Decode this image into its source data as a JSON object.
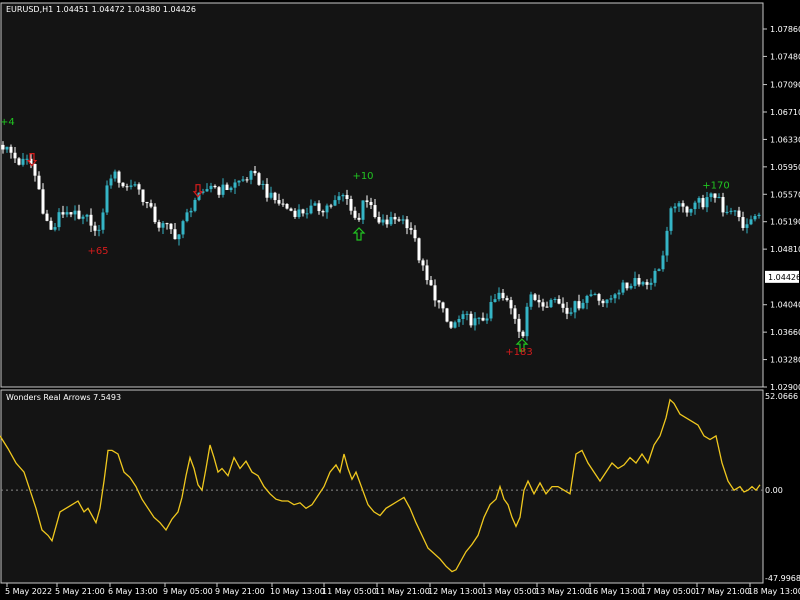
{
  "header": {
    "symbol": "EURUSD,H1",
    "ohlc": "1.04451 1.04472 1.04380 1.04426"
  },
  "indicator": {
    "name": "Wonders Real Arrows 7.5493"
  },
  "colors": {
    "background": "#000000",
    "plot_bg": "#141414",
    "axis": "#c8c8c8",
    "bull": "#35b5c6",
    "bear": "#ffffff",
    "buy": "#21c421",
    "sell": "#d41c1c",
    "osc": "#f0c81e",
    "zero": "#8a8a8a",
    "price_tag_bg": "#ffffff",
    "price_tag_fg": "#000000"
  },
  "chart_data": [
    {
      "type": "candlestick",
      "title": "EURUSD,H1",
      "ylim": [
        1.029,
        1.0822
      ],
      "y_ticks": [
        "1.07860",
        "1.07480",
        "1.07090",
        "1.06710",
        "1.06330",
        "1.05950",
        "1.05570",
        "1.05190",
        "1.04810",
        "1.04426",
        "1.04040",
        "1.03660",
        "1.03280",
        "1.02900"
      ],
      "current_price": "1.04426",
      "x_ticks": [
        "5 May 2022",
        "5 May 21:00",
        "6 May 13:00",
        "9 May 05:00",
        "9 May 21:00",
        "10 May 13:00",
        "11 May 05:00",
        "11 May 21:00",
        "12 May 13:00",
        "13 May 05:00",
        "13 May 21:00",
        "16 May 13:00",
        "17 May 05:00",
        "17 May 21:00",
        "18 May 13:00"
      ],
      "close_path": [
        [
          0,
          1.0628
        ],
        [
          10,
          1.0615
        ],
        [
          20,
          1.06
        ],
        [
          30,
          1.0603
        ],
        [
          38,
          1.057
        ],
        [
          45,
          1.0525
        ],
        [
          52,
          1.0503
        ],
        [
          60,
          1.053
        ],
        [
          70,
          1.0535
        ],
        [
          80,
          1.0518
        ],
        [
          90,
          1.0525
        ],
        [
          98,
          1.0492
        ],
        [
          104,
          1.0545
        ],
        [
          110,
          1.0585
        ],
        [
          118,
          1.058
        ],
        [
          126,
          1.0565
        ],
        [
          134,
          1.0575
        ],
        [
          142,
          1.0555
        ],
        [
          150,
          1.0535
        ],
        [
          158,
          1.0515
        ],
        [
          168,
          1.051
        ],
        [
          178,
          1.0498
        ],
        [
          186,
          1.0525
        ],
        [
          194,
          1.055
        ],
        [
          202,
          1.0552
        ],
        [
          210,
          1.0572
        ],
        [
          220,
          1.0562
        ],
        [
          230,
          1.0568
        ],
        [
          240,
          1.0575
        ],
        [
          250,
          1.0583
        ],
        [
          260,
          1.0575
        ],
        [
          270,
          1.0552
        ],
        [
          280,
          1.0545
        ],
        [
          290,
          1.0535
        ],
        [
          300,
          1.0532
        ],
        [
          310,
          1.0536
        ],
        [
          322,
          1.0538
        ],
        [
          334,
          1.0545
        ],
        [
          344,
          1.0555
        ],
        [
          352,
          1.0538
        ],
        [
          358,
          1.0512
        ],
        [
          364,
          1.0562
        ],
        [
          370,
          1.0538
        ],
        [
          378,
          1.0515
        ],
        [
          388,
          1.0518
        ],
        [
          398,
          1.0525
        ],
        [
          410,
          1.0515
        ],
        [
          418,
          1.0475
        ],
        [
          426,
          1.0438
        ],
        [
          434,
          1.042
        ],
        [
          442,
          1.0395
        ],
        [
          450,
          1.037
        ],
        [
          458,
          1.0382
        ],
        [
          468,
          1.0385
        ],
        [
          478,
          1.0378
        ],
        [
          488,
          1.0392
        ],
        [
          498,
          1.0418
        ],
        [
          508,
          1.0405
        ],
        [
          516,
          1.0385
        ],
        [
          522,
          1.0358
        ],
        [
          528,
          1.0412
        ],
        [
          536,
          1.0412
        ],
        [
          546,
          1.0408
        ],
        [
          556,
          1.0412
        ],
        [
          566,
          1.0398
        ],
        [
          576,
          1.0402
        ],
        [
          586,
          1.0415
        ],
        [
          596,
          1.0422
        ],
        [
          606,
          1.0402
        ],
        [
          616,
          1.0425
        ],
        [
          626,
          1.0428
        ],
        [
          636,
          1.0442
        ],
        [
          646,
          1.0432
        ],
        [
          656,
          1.0448
        ],
        [
          664,
          1.0475
        ],
        [
          670,
          1.0525
        ],
        [
          674,
          1.0548
        ],
        [
          680,
          1.0535
        ],
        [
          688,
          1.0538
        ],
        [
          696,
          1.0548
        ],
        [
          704,
          1.0545
        ],
        [
          712,
          1.0552
        ],
        [
          718,
          1.0558
        ],
        [
          724,
          1.0532
        ],
        [
          730,
          1.054
        ],
        [
          738,
          1.0525
        ],
        [
          746,
          1.0508
        ],
        [
          752,
          1.0525
        ],
        [
          762,
          1.0525
        ]
      ],
      "signals": [
        {
          "kind": "buy-label",
          "text": "+4",
          "x": 0,
          "y": 1.0653
        },
        {
          "kind": "sell-arrow",
          "x": 32,
          "y": 1.0605
        },
        {
          "kind": "sell-label",
          "text": "+65",
          "x": 98,
          "y": 1.0474
        },
        {
          "kind": "sell-arrow",
          "x": 198,
          "y": 1.0562
        },
        {
          "kind": "buy-label",
          "text": "+10",
          "x": 363,
          "y": 1.0578
        },
        {
          "kind": "buy-arrow",
          "x": 359,
          "y": 1.0502
        },
        {
          "kind": "buy-arrow",
          "x": 522,
          "y": 1.0348
        },
        {
          "kind": "sell-label",
          "text": "+183",
          "x": 519,
          "y": 1.0334
        },
        {
          "kind": "buy-label",
          "text": "+170",
          "x": 716,
          "y": 1.0565
        }
      ]
    },
    {
      "type": "line",
      "title": "Wonders Real Arrows 7.5493",
      "ylim": [
        -47.9968,
        52.0666
      ],
      "y_ticks": [
        "52.0666",
        "0.00",
        "-47.9968"
      ],
      "zero_line": "dashed",
      "points": [
        [
          0,
          30
        ],
        [
          8,
          23
        ],
        [
          16,
          15
        ],
        [
          24,
          10
        ],
        [
          30,
          0
        ],
        [
          36,
          -10
        ],
        [
          42,
          -22
        ],
        [
          48,
          -25
        ],
        [
          52,
          -28
        ],
        [
          56,
          -20
        ],
        [
          60,
          -12
        ],
        [
          66,
          -10
        ],
        [
          72,
          -8
        ],
        [
          78,
          -6
        ],
        [
          84,
          -12
        ],
        [
          88,
          -10
        ],
        [
          92,
          -14
        ],
        [
          96,
          -18
        ],
        [
          100,
          -10
        ],
        [
          104,
          5
        ],
        [
          108,
          22
        ],
        [
          112,
          22
        ],
        [
          118,
          20
        ],
        [
          124,
          10
        ],
        [
          130,
          7
        ],
        [
          136,
          2
        ],
        [
          142,
          -5
        ],
        [
          148,
          -10
        ],
        [
          154,
          -15
        ],
        [
          160,
          -18
        ],
        [
          166,
          -22
        ],
        [
          172,
          -16
        ],
        [
          178,
          -12
        ],
        [
          182,
          -4
        ],
        [
          186,
          8
        ],
        [
          190,
          18
        ],
        [
          194,
          12
        ],
        [
          198,
          3
        ],
        [
          202,
          0
        ],
        [
          206,
          12
        ],
        [
          210,
          25
        ],
        [
          214,
          18
        ],
        [
          218,
          10
        ],
        [
          222,
          12
        ],
        [
          228,
          8
        ],
        [
          234,
          18
        ],
        [
          240,
          12
        ],
        [
          246,
          16
        ],
        [
          252,
          10
        ],
        [
          258,
          8
        ],
        [
          264,
          2
        ],
        [
          270,
          -2
        ],
        [
          276,
          -5
        ],
        [
          282,
          -6
        ],
        [
          288,
          -6
        ],
        [
          294,
          -8
        ],
        [
          300,
          -7
        ],
        [
          306,
          -10
        ],
        [
          312,
          -8
        ],
        [
          318,
          -3
        ],
        [
          324,
          2
        ],
        [
          330,
          10
        ],
        [
          336,
          14
        ],
        [
          340,
          10
        ],
        [
          344,
          20
        ],
        [
          348,
          12
        ],
        [
          352,
          6
        ],
        [
          356,
          10
        ],
        [
          360,
          4
        ],
        [
          364,
          -2
        ],
        [
          368,
          -8
        ],
        [
          374,
          -12
        ],
        [
          380,
          -14
        ],
        [
          386,
          -10
        ],
        [
          392,
          -8
        ],
        [
          398,
          -6
        ],
        [
          404,
          -4
        ],
        [
          410,
          -10
        ],
        [
          416,
          -18
        ],
        [
          422,
          -25
        ],
        [
          428,
          -32
        ],
        [
          434,
          -35
        ],
        [
          440,
          -38
        ],
        [
          446,
          -42
        ],
        [
          452,
          -45
        ],
        [
          456,
          -44
        ],
        [
          460,
          -40
        ],
        [
          466,
          -34
        ],
        [
          472,
          -30
        ],
        [
          478,
          -25
        ],
        [
          484,
          -15
        ],
        [
          490,
          -8
        ],
        [
          496,
          -5
        ],
        [
          500,
          2
        ],
        [
          504,
          -5
        ],
        [
          508,
          -8
        ],
        [
          512,
          -15
        ],
        [
          516,
          -20
        ],
        [
          520,
          -15
        ],
        [
          524,
          0
        ],
        [
          528,
          5
        ],
        [
          534,
          -2
        ],
        [
          540,
          4
        ],
        [
          546,
          -2
        ],
        [
          552,
          2
        ],
        [
          558,
          2
        ],
        [
          564,
          0
        ],
        [
          570,
          -2
        ],
        [
          576,
          20
        ],
        [
          582,
          22
        ],
        [
          588,
          15
        ],
        [
          594,
          10
        ],
        [
          600,
          5
        ],
        [
          606,
          10
        ],
        [
          612,
          15
        ],
        [
          618,
          12
        ],
        [
          624,
          14
        ],
        [
          630,
          18
        ],
        [
          636,
          15
        ],
        [
          642,
          20
        ],
        [
          648,
          15
        ],
        [
          654,
          25
        ],
        [
          660,
          30
        ],
        [
          666,
          40
        ],
        [
          670,
          50
        ],
        [
          674,
          48
        ],
        [
          680,
          42
        ],
        [
          686,
          40
        ],
        [
          692,
          38
        ],
        [
          698,
          36
        ],
        [
          704,
          30
        ],
        [
          710,
          28
        ],
        [
          716,
          30
        ],
        [
          722,
          15
        ],
        [
          728,
          5
        ],
        [
          734,
          0
        ],
        [
          740,
          2
        ],
        [
          744,
          -1
        ],
        [
          748,
          0
        ],
        [
          752,
          2
        ],
        [
          756,
          0
        ],
        [
          760,
          3
        ]
      ]
    }
  ]
}
